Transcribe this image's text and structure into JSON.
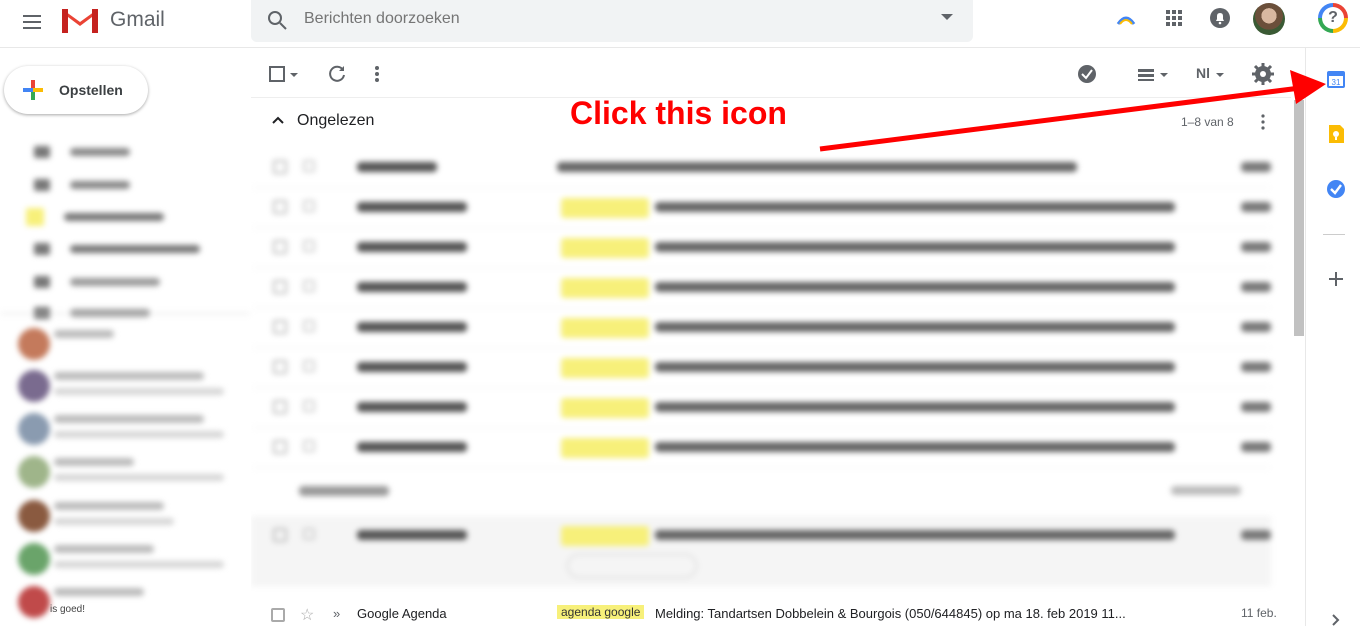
{
  "header": {
    "app_name": "Gmail",
    "search_placeholder": "Berichten doorzoeken",
    "icons": [
      "menu-icon",
      "gmail-logo-icon",
      "search-icon",
      "search-options-icon",
      "google-one-icon",
      "apps-grid-icon",
      "notifications-icon",
      "avatar",
      "help-icon"
    ]
  },
  "compose": {
    "label": "Opstellen"
  },
  "toolbar": {
    "language_label": "Nl",
    "icons": [
      "select-all-checkbox",
      "refresh-icon",
      "more-icon",
      "tasks-check-icon",
      "density-icon",
      "language-dropdown",
      "settings-icon"
    ]
  },
  "inbox": {
    "section_title": "Ongelezen",
    "section_count": "1–8 van 8"
  },
  "last_row": {
    "importance": "»",
    "sender": "Google Agenda",
    "tag": "agenda google",
    "subject": "Melding: Tandartsen Dobbelein & Bourgois (050/644845) op ma 18. feb 2019 11...",
    "date": "11 feb."
  },
  "chat_footer": "is goed!",
  "right_rail": {
    "items": [
      "calendar-icon",
      "keep-icon",
      "tasks-icon",
      "add-addon-icon",
      "expand-icon"
    ]
  },
  "annotation": {
    "text": "Click this icon",
    "color": "#ff0000"
  },
  "colors": {
    "accent_blue": "#4285f4",
    "gmail_red": "#ea4335",
    "highlight_yellow": "#f7f07a"
  }
}
